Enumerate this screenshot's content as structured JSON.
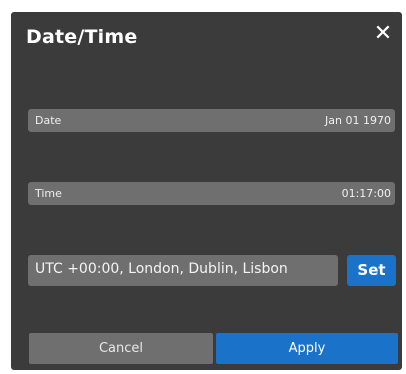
{
  "dialog": {
    "title": "Date/Time",
    "close_icon": "close-icon"
  },
  "date": {
    "label": "Date",
    "value": "Jan 01 1970"
  },
  "time": {
    "label": "Time",
    "value": "01:17:00"
  },
  "timezone": {
    "value": "UTC +00:00, London, Dublin, Lisbon",
    "set_label": "Set"
  },
  "actions": {
    "cancel_label": "Cancel",
    "apply_label": "Apply"
  },
  "colors": {
    "background": "#3b3b3b",
    "field": "#6f6f6f",
    "accent": "#1a73c8"
  }
}
